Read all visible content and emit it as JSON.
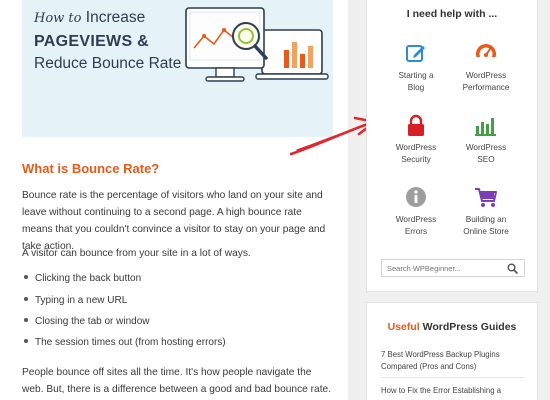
{
  "hero": {
    "line1_italic": "How to",
    "line1_rest": "Increase",
    "line2": "PAGEVIEWS &",
    "line3": "Reduce Bounce Rate"
  },
  "article": {
    "heading": "What is Bounce Rate?",
    "p1": "Bounce rate is the percentage of visitors who land on your site and leave without continuing to a second page. A high bounce rate means that you couldn't convince a visitor to stay on your page and take action.",
    "p2": "A visitor can bounce from your site in a lot of ways.",
    "bullets": [
      "Clicking the back button",
      "Typing in a new URL",
      "Closing the tab or window",
      "The session times out (from hosting errors)"
    ],
    "p3": "People bounce off sites all the time. It's how people navigate the web. But, there is a difference between a good and bad bounce rate."
  },
  "sidebar": {
    "help_title": "I need help with ...",
    "tiles": [
      {
        "line1": "Starting a",
        "line2": "Blog",
        "icon": "pencil-edit-icon",
        "color": "#2f8ad8"
      },
      {
        "line1": "WordPress",
        "line2": "Performance",
        "icon": "speedometer-icon",
        "color": "#e8591a"
      },
      {
        "line1": "WordPress",
        "line2": "Security",
        "icon": "lock-icon",
        "color": "#d81f26"
      },
      {
        "line1": "WordPress",
        "line2": "SEO",
        "icon": "bar-chart-icon",
        "color": "#43a047"
      },
      {
        "line1": "WordPress",
        "line2": "Errors",
        "icon": "info-icon",
        "color": "#9e9e9e"
      },
      {
        "line1": "Building an",
        "line2": "Online Store",
        "icon": "shopping-cart-icon",
        "color": "#7b3fb5"
      }
    ],
    "search_placeholder": "Search WPBeginner...",
    "guides_title_highlight": "Useful",
    "guides_title_rest": "WordPress Guides",
    "guides": [
      "7 Best WordPress Backup Plugins Compared (Pros and Cons)",
      "How to Fix the Error Establishing a"
    ]
  },
  "colors": {
    "accent": "#e8591a",
    "arrow": "#e0282e"
  }
}
